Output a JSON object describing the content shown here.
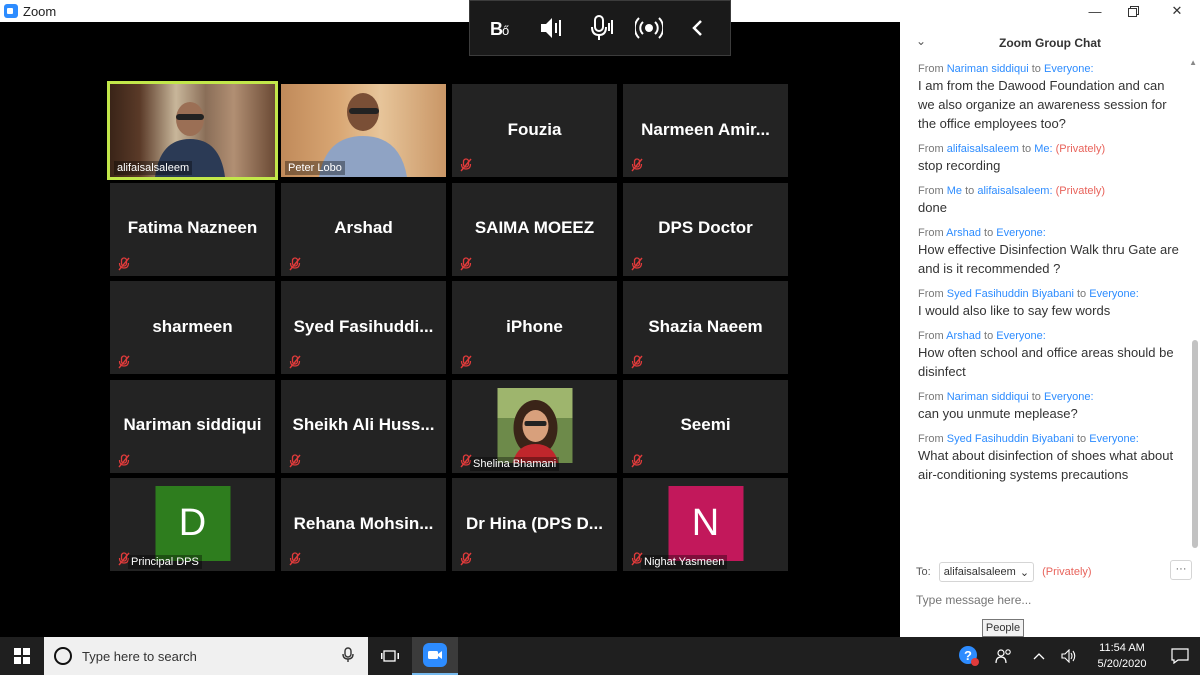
{
  "window": {
    "title": "Zoom"
  },
  "toolbar": {
    "icons": [
      "manage-participants-icon",
      "speaker-icon",
      "microphone-icon",
      "share-audio-icon",
      "collapse-arrow-icon"
    ]
  },
  "participants": [
    {
      "name": "alifaisalsaleem",
      "display": "video",
      "active": true
    },
    {
      "name": "Peter Lobo",
      "display": "video"
    },
    {
      "name": "Fouzia",
      "display": "name"
    },
    {
      "name": "Narmeen  Amir...",
      "display": "name"
    },
    {
      "name": "Fatima Nazneen",
      "display": "name"
    },
    {
      "name": "Arshad",
      "display": "name"
    },
    {
      "name": "SAIMA MOEEZ",
      "display": "name"
    },
    {
      "name": "DPS Doctor",
      "display": "name"
    },
    {
      "name": "sharmeen",
      "display": "name"
    },
    {
      "name": "Syed  Fasihuddi...",
      "display": "name"
    },
    {
      "name": "iPhone",
      "display": "name"
    },
    {
      "name": "Shazia Naeem",
      "display": "name"
    },
    {
      "name": "Nariman siddiqui",
      "display": "name"
    },
    {
      "name": "Sheikh  Ali  Huss...",
      "display": "name"
    },
    {
      "name": "Shelina Bhamani",
      "display": "photo"
    },
    {
      "name": "Seemi",
      "display": "name"
    },
    {
      "name": "Principal DPS",
      "display": "avatar",
      "initial": "D",
      "color": "#2e7d1e"
    },
    {
      "name": "Rehana  Mohsin...",
      "display": "name"
    },
    {
      "name": "Dr Hina (DPS D...",
      "display": "name"
    },
    {
      "name": "Nighat Yasmeen",
      "display": "avatar",
      "initial": "N",
      "color": "#c2185b"
    }
  ],
  "chat": {
    "title": "Zoom Group Chat",
    "messages": [
      {
        "from": "Nariman siddiqui",
        "to": "Everyone:",
        "private": "",
        "text": "I am from the Dawood Foundation and can we also organize an awareness session for the office employees too?"
      },
      {
        "from": "alifaisalsaleem",
        "to": "Me:",
        "private": "(Privately)",
        "text": "stop recording"
      },
      {
        "from": "Me",
        "to": "alifaisalsaleem:",
        "private": "(Privately)",
        "text": "done"
      },
      {
        "from": "Arshad",
        "to": "Everyone:",
        "private": "",
        "text": "How effective Disinfection Walk thru Gate are and is it recommended ?"
      },
      {
        "from": "Syed Fasihuddin Biyabani",
        "to": "Everyone:",
        "private": "",
        "text": "I would also like to say few words"
      },
      {
        "from": "Arshad",
        "to": "Everyone:",
        "private": "",
        "text": "How often school and office areas should be disinfect"
      },
      {
        "from": "Nariman siddiqui",
        "to": "Everyone:",
        "private": "",
        "text": "can you unmute meplease?"
      },
      {
        "from": "Syed Fasihuddin Biyabani",
        "to": "Everyone:",
        "private": "",
        "text": "What about disinfection of shoes what about air-conditioning systems precautions"
      }
    ],
    "from_word": "From",
    "to_word": "to",
    "to_label": "To:",
    "recipient": "alifaisalsaleem",
    "recipient_privacy": "(Privately)",
    "more_label": "···",
    "input_placeholder": "Type message here..."
  },
  "tooltip": "People",
  "taskbar": {
    "search_placeholder": "Type here to search",
    "time": "11:54 AM",
    "date": "5/20/2020"
  },
  "colors": {
    "active_border": "#c2e74a",
    "link": "#2d8cff",
    "private": "#e8635b",
    "mute": "#e03b3b"
  }
}
